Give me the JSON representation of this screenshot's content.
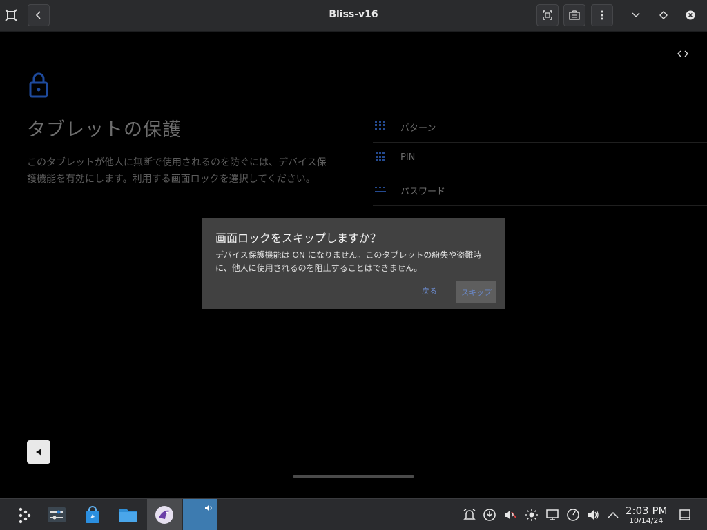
{
  "window": {
    "title": "Bliss-v16"
  },
  "page": {
    "title": "タブレットの保護",
    "description": "このタブレットが他人に無断で使用されるのを防ぐには、デバイス保護機能を有効にします。利用する画面ロックを選択してください。",
    "options": [
      {
        "label": "パターン",
        "icon": "pattern-grid-icon"
      },
      {
        "label": "PIN",
        "icon": "pin-grid-icon"
      },
      {
        "label": "パスワード",
        "icon": "password-dots-icon"
      }
    ]
  },
  "dialog": {
    "title": "画面ロックをスキップしますか？",
    "message": "デバイス保護機能は ON になりません。このタブレットの紛失や盗難時に、他人に使用されるのを阻止することはできません。",
    "back_label": "戻る",
    "skip_label": "スキップ"
  },
  "taskbar": {
    "time": "2:03 PM",
    "date": "10/14/24"
  },
  "colors": {
    "accent": "#2a5ab0",
    "dialog_bg": "#414141",
    "button_text": "#6a88c8",
    "titlebar": "#2a2b2d",
    "taskbar": "#2a2b2e"
  }
}
